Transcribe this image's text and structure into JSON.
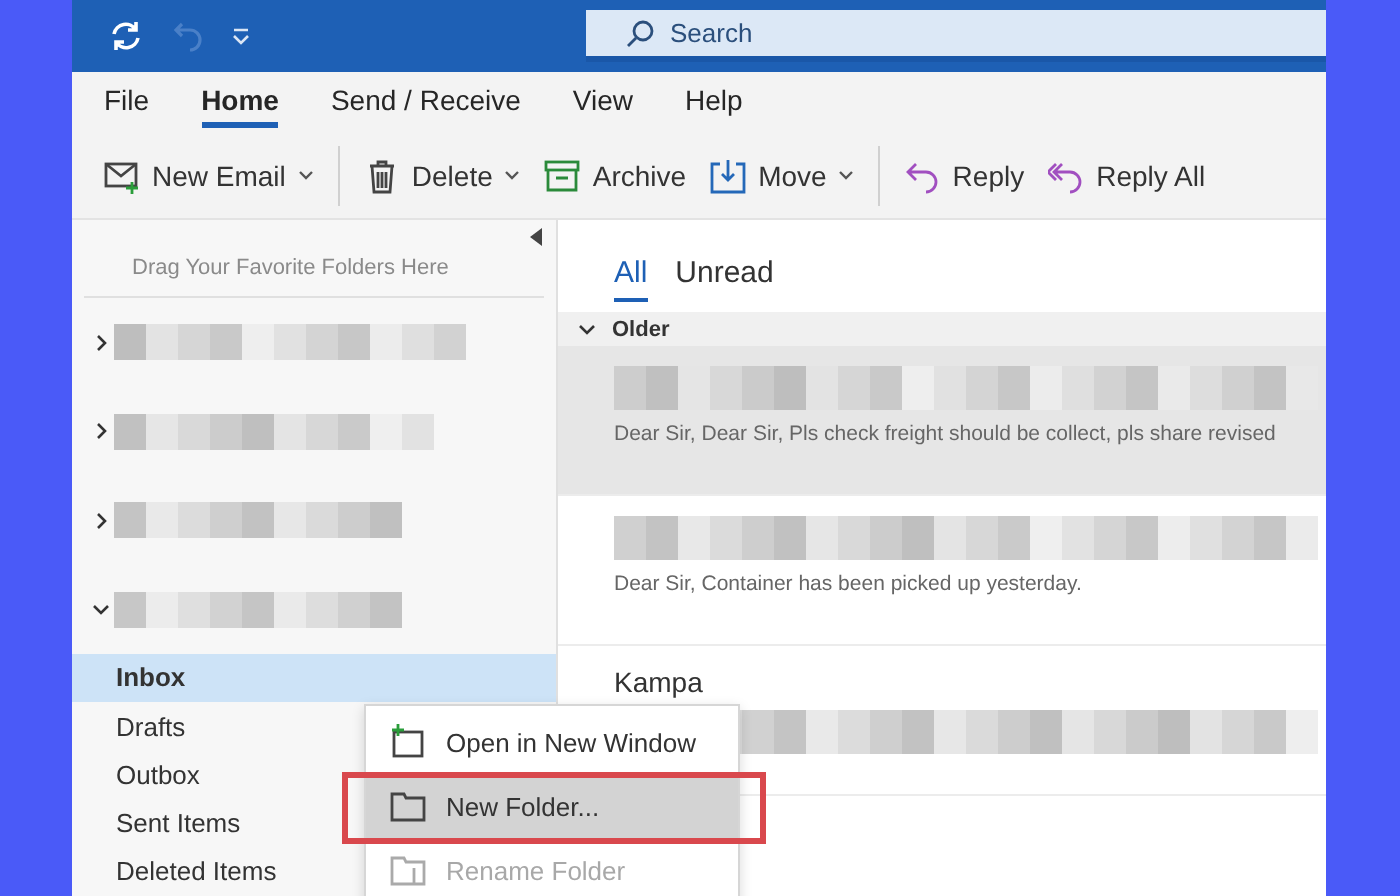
{
  "title_bar": {
    "search": {
      "placeholder": "Search"
    },
    "undo_disabled": true
  },
  "menu_tabs": [
    {
      "label": "File",
      "selected": false
    },
    {
      "label": "Home",
      "selected": true
    },
    {
      "label": "Send / Receive",
      "selected": false
    },
    {
      "label": "View",
      "selected": false
    },
    {
      "label": "Help",
      "selected": false
    }
  ],
  "toolbar": [
    {
      "buttons": [
        {
          "kind": "mail",
          "label": "New Email",
          "dropdown": true
        }
      ]
    },
    {
      "buttons": [
        {
          "kind": "trash",
          "label": "Delete",
          "dropdown": true
        },
        {
          "kind": "archive",
          "label": "Archive",
          "dropdown": false
        },
        {
          "kind": "move",
          "label": "Move",
          "dropdown": true
        }
      ]
    },
    {
      "buttons": [
        {
          "kind": "reply",
          "label": "Reply",
          "dropdown": false
        },
        {
          "kind": "replyall",
          "label": "Reply All",
          "dropdown": false
        }
      ]
    }
  ],
  "folder_pane": {
    "favorites_hint": "Drag Your Favorite Folders Here",
    "accounts": [
      {
        "expanded": false
      },
      {
        "expanded": false
      },
      {
        "expanded": false
      },
      {
        "expanded": true,
        "folders": [
          {
            "label": "Inbox",
            "selected": true
          },
          {
            "label": "Drafts",
            "selected": false
          },
          {
            "label": "Outbox",
            "selected": false
          },
          {
            "label": "Sent Items",
            "selected": false
          },
          {
            "label": "Deleted Items",
            "selected": false
          }
        ]
      }
    ]
  },
  "message_list": {
    "filters": [
      {
        "label": "All",
        "selected": true
      },
      {
        "label": "Unread",
        "selected": false
      }
    ],
    "group": {
      "label": "Older",
      "expanded": true
    },
    "messages": [
      {
        "selected": true,
        "preview": "Dear Sir,  Dear Sir,  Pls check freight should be collect, pls share revised"
      },
      {
        "selected": false,
        "preview": "Dear Sir,  Container has been picked up yesterday."
      },
      {
        "selected": false,
        "sender": "Kampa"
      }
    ]
  },
  "context_menu": [
    {
      "kind": "open",
      "label": "Open in New Window",
      "disabled": false,
      "highlighted": false
    },
    {
      "kind": "folder",
      "label": "New Folder...",
      "disabled": false,
      "highlighted": true
    },
    {
      "kind": "rename",
      "label": "Rename Folder",
      "disabled": true,
      "highlighted": false
    }
  ]
}
